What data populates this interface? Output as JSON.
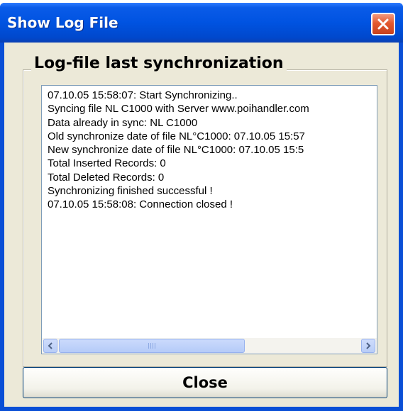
{
  "window": {
    "title": "Show Log File"
  },
  "group": {
    "legend": "Log-file last synchronization"
  },
  "log": {
    "lines": [
      "07.10.05 15:58:07: Start Synchronizing..",
      "Syncing file NL C1000 with Server www.poihandler.com",
      "Data already in sync: NL C1000",
      "Old synchronize date of file NL°C1000: 07.10.05 15:57",
      "New synchronize date of file NL°C1000: 07.10.05 15:5",
      "Total Inserted Records: 0",
      "Total Deleted Records: 0",
      "Synchronizing finished successful !",
      "07.10.05 15:58:08: Connection closed !"
    ]
  },
  "buttons": {
    "close_label": "Close"
  },
  "colors": {
    "titlebar": "#0053e1",
    "window_face": "#ece9d8",
    "close_x": "#e3582f"
  }
}
